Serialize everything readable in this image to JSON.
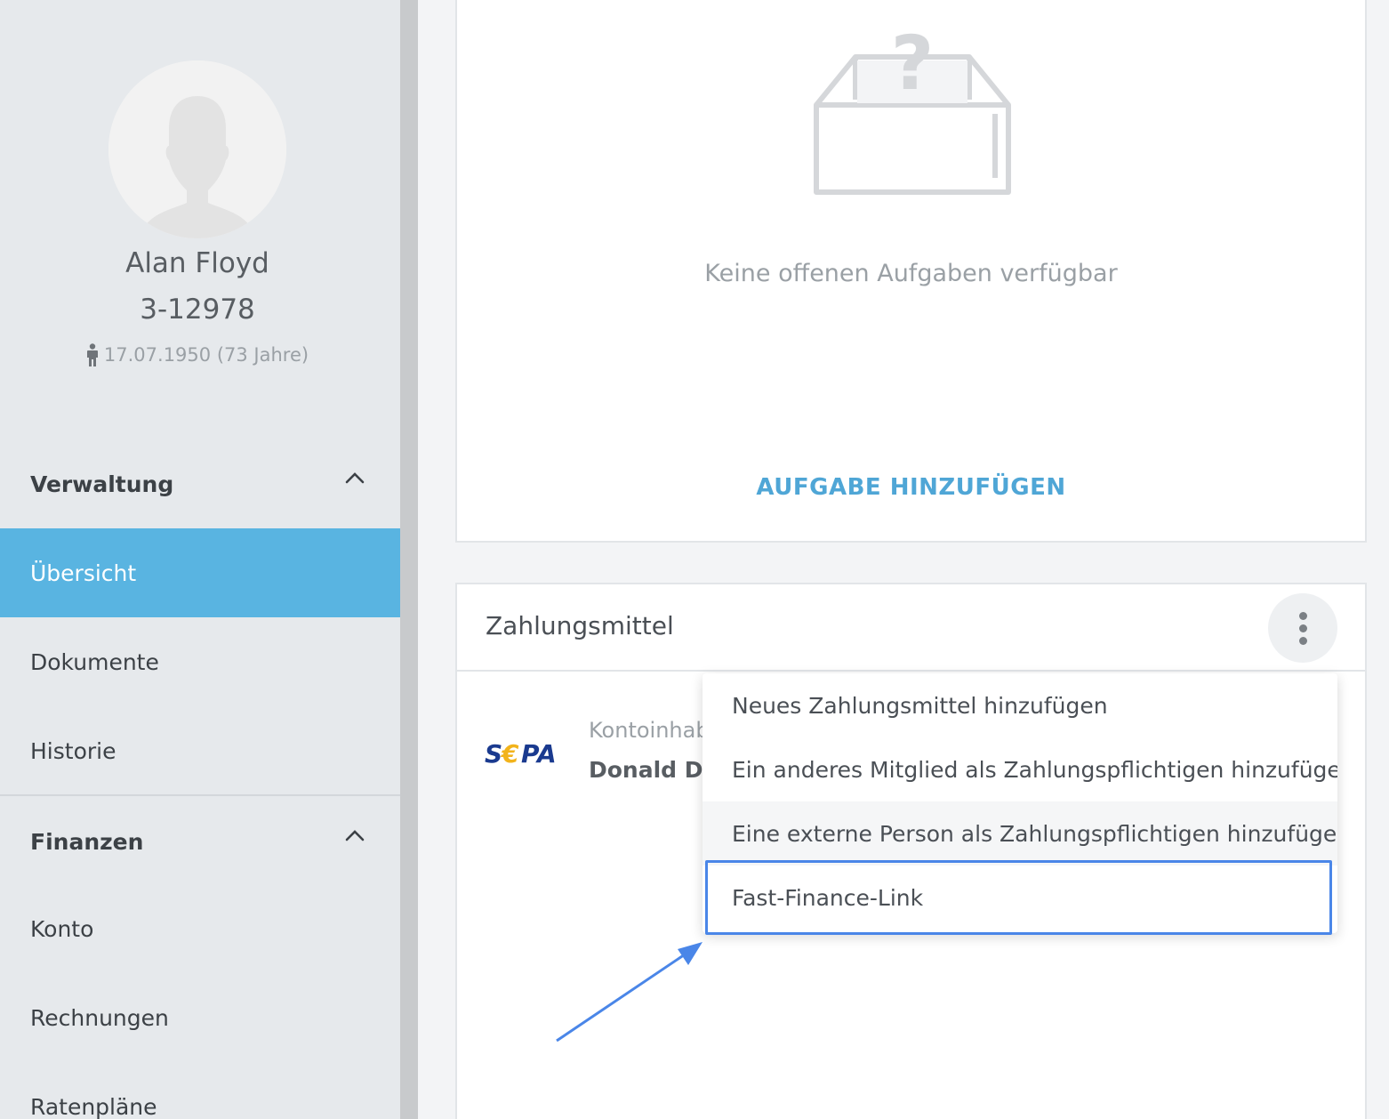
{
  "profile": {
    "name": "Alan Floyd",
    "member_id": "3-12978",
    "birth": "17.07.1950 (73 Jahre)",
    "avatar_icon": "user-silhouette-icon"
  },
  "sidebar": {
    "sections": [
      {
        "label": "Verwaltung",
        "expanded": true,
        "items": [
          {
            "label": "Übersicht",
            "active": true
          },
          {
            "label": "Dokumente"
          },
          {
            "label": "Historie"
          }
        ]
      },
      {
        "label": "Finanzen",
        "expanded": true,
        "items": [
          {
            "label": "Konto"
          },
          {
            "label": "Rechnungen"
          },
          {
            "label": "Ratenpläne"
          }
        ]
      }
    ]
  },
  "tasks": {
    "empty_text": "Keine offenen Aufgaben verfügbar",
    "add_label": "AUFGABE HINZUFÜGEN"
  },
  "payment": {
    "title": "Zahlungsmittel",
    "method": "SEPA",
    "holder_label": "Kontoinhab",
    "holder_name": "Donald Duc"
  },
  "menu": {
    "items": [
      "Neues Zahlungsmittel hinzufügen",
      "Ein anderes Mitglied als Zahlungspflichtigen hinzufügen",
      "Eine externe Person als Zahlungspflichtigen hinzufügen",
      "Fast-Finance-Link"
    ],
    "highlighted_index": 3
  },
  "colors": {
    "accent": "#59b4e1",
    "link": "#4fa6d6",
    "annotation": "#4a86e8"
  }
}
